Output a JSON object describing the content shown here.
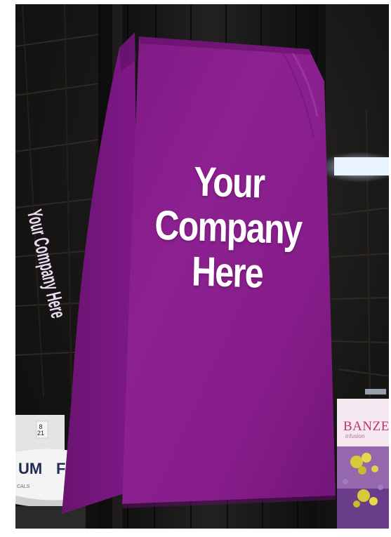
{
  "banner": {
    "line1": "Your",
    "line2": "Company",
    "line3": "Here"
  },
  "side_banner": {
    "text": "Your Company Here"
  },
  "background_signs": {
    "booth_number": "8\n21",
    "left_sign_a": "UM",
    "left_sign_b": "F",
    "left_sign_small": "CALS",
    "right_sign": "BANZE",
    "right_sign_small": "infusion"
  },
  "colors": {
    "banner_purple": "#8a1f8c",
    "banner_purple_dark": "#6c1470",
    "side_banner": "#7b1a80",
    "pole": "#161514",
    "ceiling_light": "#e8f1ff",
    "right_booth_wall": "#f7eaf2",
    "left_booth_sign": "#f2f2f2"
  }
}
